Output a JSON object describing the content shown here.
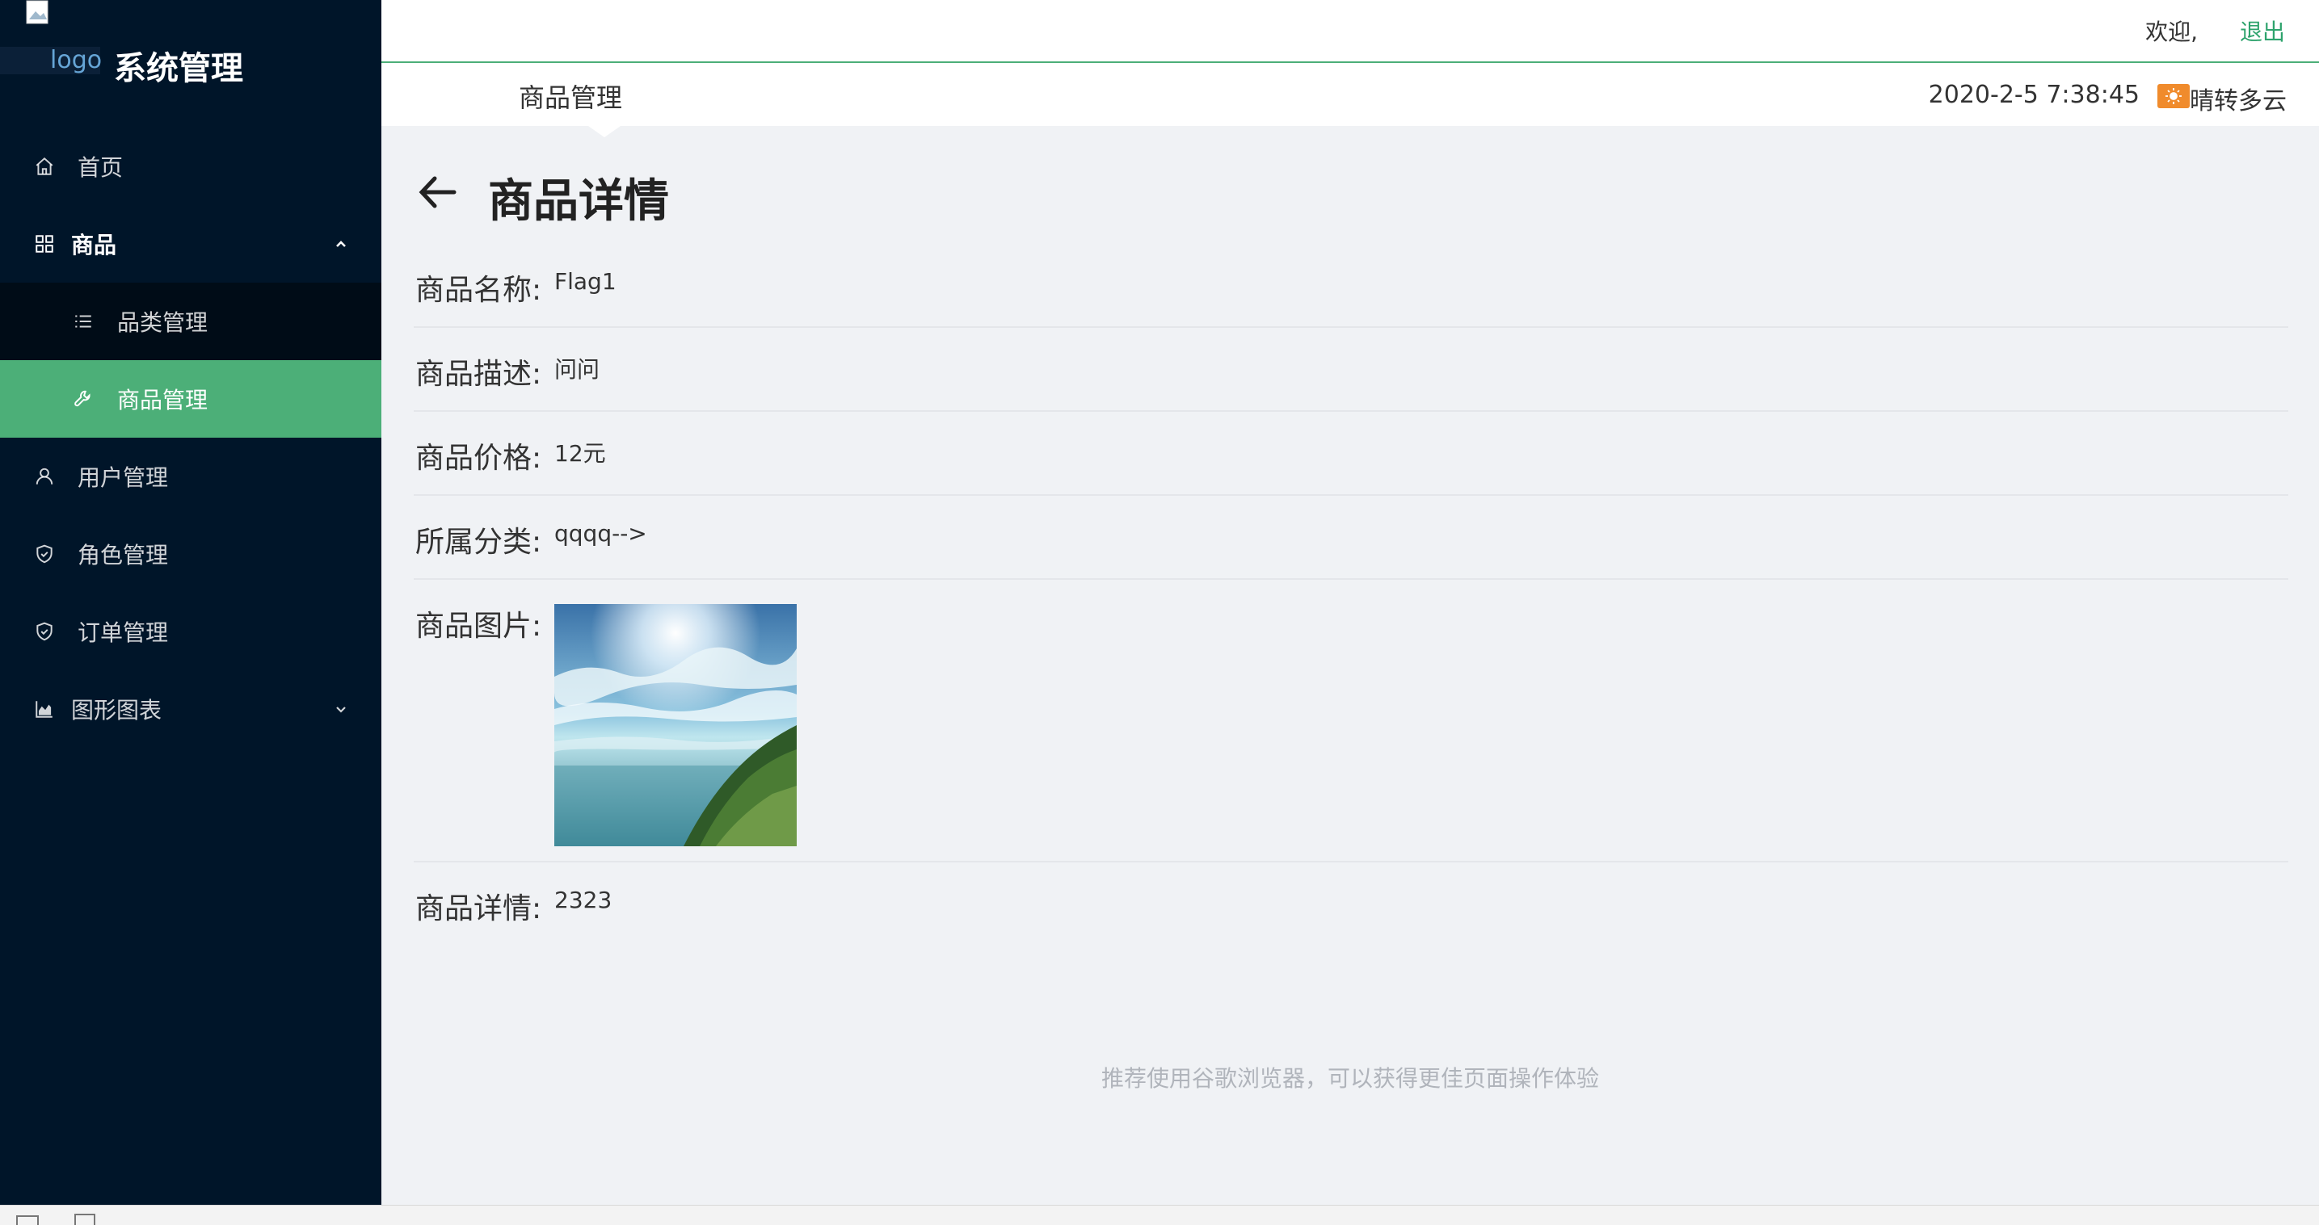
{
  "sidebar": {
    "logo_alt": "logo",
    "title": "系统管理",
    "items": [
      {
        "label": "首页",
        "icon": "home-icon"
      },
      {
        "label": "商品",
        "icon": "appstore-icon"
      },
      {
        "label": "用户管理",
        "icon": "user-icon"
      },
      {
        "label": "角色管理",
        "icon": "safety-icon"
      },
      {
        "label": "订单管理",
        "icon": "safety-icon"
      },
      {
        "label": "图形图表",
        "icon": "area-chart-icon"
      }
    ],
    "submenu": [
      {
        "label": "品类管理",
        "icon": "bars-icon"
      },
      {
        "label": "商品管理",
        "icon": "tool-icon"
      }
    ],
    "active_color": "#4caf78",
    "bg_color": "#001529"
  },
  "header": {
    "welcome": "欢迎,",
    "logout": "退出",
    "section_title": "商品管理",
    "datetime": "2020-2-5 7:38:45",
    "weather": "晴转多云",
    "weather_icon": "sun-icon"
  },
  "detail": {
    "title": "商品详情",
    "rows": [
      {
        "label": "商品名称:",
        "value": "Flag1"
      },
      {
        "label": "商品描述:",
        "value": "问问"
      },
      {
        "label": "商品价格:",
        "value": "12元"
      },
      {
        "label": "所属分类:",
        "value": "qqqq-->"
      },
      {
        "label": "商品图片:",
        "value": ""
      },
      {
        "label": "商品详情:",
        "value": "2323"
      }
    ]
  },
  "footer_tip": "推荐使用谷歌浏览器，可以获得更佳页面操作体验"
}
